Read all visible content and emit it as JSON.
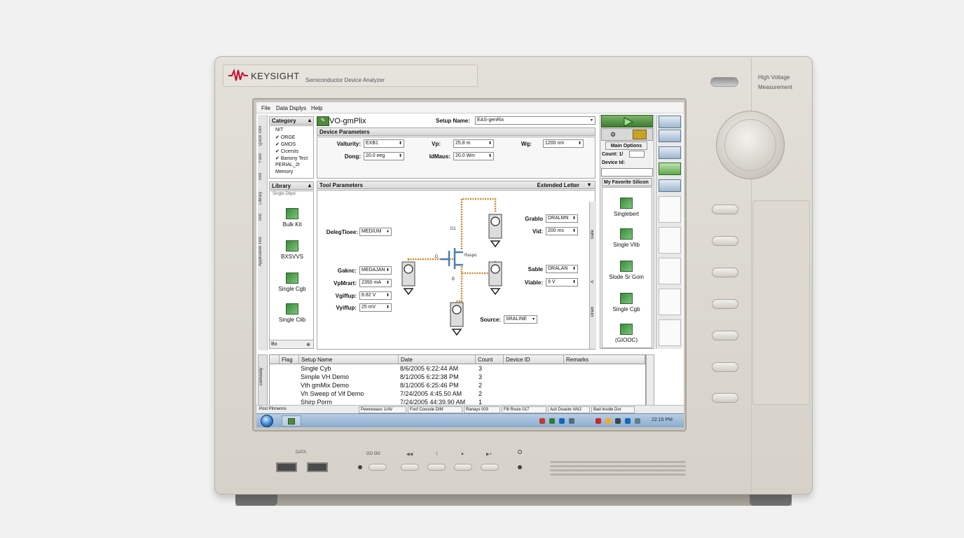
{
  "instrument": {
    "brand": "KEYSIGHT",
    "model": "Semiconductor Device Analyzer",
    "hv_label_1": "High Voltage",
    "hv_label_2": "Measurement",
    "usb_label": "DATA",
    "front_buttons": [
      "ΩΩ ΩΩ",
      "◀◀",
      "|",
      "▲",
      "▶+"
    ]
  },
  "menu": {
    "file": "File",
    "data_display": "Data Dsplys",
    "help": "Help"
  },
  "side_tabs": [
    "Quick Tool",
    "Favo",
    "Tool",
    "Library",
    "Test",
    "Application Test"
  ],
  "category": {
    "header": "Category",
    "items": [
      "NIT",
      "ORGE",
      "GMOS",
      "Cicersts",
      "Bariony Tect",
      "PERIAL_2t",
      "Memory"
    ]
  },
  "library": {
    "header": "Library",
    "top_item": "Single Dbpd",
    "items": [
      "Bulk Kit",
      "BXSVVS",
      "Single Cgb",
      "Single Clib"
    ],
    "footer": "Bo"
  },
  "setup": {
    "title": "VO-gmPlix",
    "name_label": "Setup Name:",
    "name_value": "EAS-genRix"
  },
  "device_params": {
    "header": "Device Parameters",
    "fields": [
      {
        "label": "Valturity:",
        "value": "EXB1"
      },
      {
        "label": "Vp:",
        "value": "25.8 m"
      },
      {
        "label": "Wg:",
        "value": "1200 nm"
      },
      {
        "label": "Dong:",
        "value": "20.0 eeg"
      },
      {
        "label": "IdMaus:",
        "value": "20.0 Wm"
      }
    ]
  },
  "tool_params": {
    "header": "Tool Parameters",
    "extended": "Extended Letter",
    "fields": [
      {
        "label": "DelegTioee:",
        "value": "MEDIUM"
      },
      {
        "label": "Gaknc:",
        "value": "MEDAJAN"
      },
      {
        "label": "VpMrart:",
        "value": "2350 mA"
      },
      {
        "label": "Vgiffup:",
        "value": "8.82 V"
      },
      {
        "label": "Vyiffup:",
        "value": "25 mV"
      },
      {
        "label": "Grablo",
        "value": "DRALMN"
      },
      {
        "label": "Vid:",
        "value": "200 ms"
      },
      {
        "label": "Sable",
        "value": "DRALAN"
      },
      {
        "label": "Viable:",
        "value": "9 V"
      },
      {
        "label": "Source:",
        "value": "SRALINE"
      }
    ],
    "node_labels": [
      "D1",
      "D",
      "Raspo",
      "B"
    ]
  },
  "toolbox": {
    "main_options": "Main Options",
    "count_label": "Count: 1/",
    "device_id_label": "Device Id:",
    "favorite": "My Favorite Silicon",
    "fav_items": [
      "Singlebert",
      "Single Vlib",
      "Slode Sr Goin",
      "Single Cgb",
      "(GIOOC)"
    ],
    "side_tabs": [
      "Gate",
      "Drain"
    ]
  },
  "table": {
    "columns": [
      "Flag",
      "Setup Name",
      "Date",
      "Count",
      "Device ID",
      "Remarks"
    ],
    "rows": [
      {
        "name": "Single Cyb",
        "date": "8/6/2005 6:22:44 AM",
        "count": "3"
      },
      {
        "name": "Simple VH Demo",
        "date": "8/1/2005 6:22:38 PM",
        "count": "3"
      },
      {
        "name": "Vth gmMix Demo",
        "date": "8/1/2005 6:25:46 PM",
        "count": "2"
      },
      {
        "name": "Vh Sweep of Vif Demo",
        "date": "7/24/2005 4:45.50 AM",
        "count": "2"
      },
      {
        "name": "Shirp Porm",
        "date": "7/24/2005 44:39.90 AM",
        "count": "1"
      }
    ],
    "side_label": "Demosity"
  },
  "status": {
    "left": "Post Plnnenns",
    "cells": [
      "Pewnoeass 1/AV",
      "Focf Coossle DIM",
      "Ranays 003",
      "Filt Rsoix 017",
      "Acit Doaste VAI2",
      "Bad Inside Dor"
    ]
  },
  "taskbar": {
    "clock": "22:15 PM"
  },
  "colors": {
    "brand_red": "#c8102e",
    "run_green": "#4d8a3d",
    "wire_orange": "#c9892e",
    "fet_blue": "#4a7fb5"
  }
}
